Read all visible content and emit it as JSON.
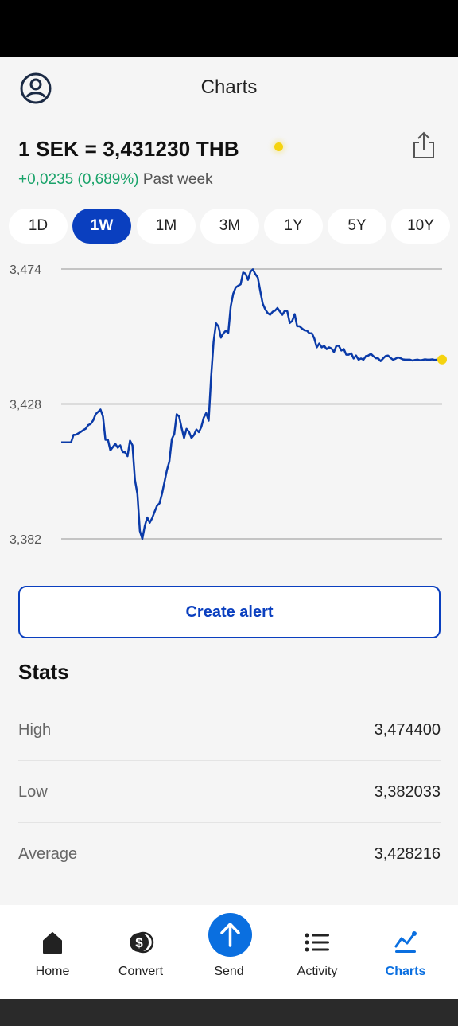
{
  "header": {
    "title": "Charts"
  },
  "rate": {
    "pair_text": "1 SEK = 3,431230 THB",
    "change_value": "+0,0235 (0,689%)",
    "change_period": "Past week"
  },
  "ranges": [
    {
      "label": "1D",
      "active": false
    },
    {
      "label": "1W",
      "active": true
    },
    {
      "label": "1M",
      "active": false
    },
    {
      "label": "3M",
      "active": false
    },
    {
      "label": "1Y",
      "active": false
    },
    {
      "label": "5Y",
      "active": false
    },
    {
      "label": "10Y",
      "active": false
    }
  ],
  "chart_data": {
    "type": "line",
    "title": "",
    "xlabel": "",
    "ylabel": "",
    "ylim": [
      3.382,
      3.474
    ],
    "y_ticks": [
      "3,474",
      "3,428",
      "3,382"
    ],
    "grid": true,
    "line_color": "#0a3aa8",
    "end_marker_color": "#f5d30f",
    "series": [
      {
        "values": [
          3.4149,
          3.4149,
          3.4149,
          3.4149,
          3.4149,
          3.4175,
          3.4175,
          3.418,
          3.4185,
          3.4191,
          3.4196,
          3.4208,
          3.4212,
          3.4224,
          3.4245,
          3.4253,
          3.4261,
          3.4237,
          3.4158,
          3.4158,
          3.4122,
          3.4133,
          3.4144,
          3.4131,
          3.4139,
          3.4116,
          3.4115,
          3.4102,
          3.4155,
          3.4139,
          3.4021,
          3.3973,
          3.3847,
          3.382,
          3.3864,
          3.3893,
          3.3875,
          3.389,
          3.3912,
          3.3933,
          3.3941,
          3.3973,
          3.4013,
          3.4054,
          3.4084,
          3.416,
          3.4178,
          3.4245,
          3.4237,
          3.4198,
          3.4164,
          3.4195,
          3.4185,
          3.4164,
          3.4174,
          3.4193,
          3.4184,
          3.4201,
          3.4233,
          3.4249,
          3.4223,
          3.4372,
          3.4492,
          3.4555,
          3.4544,
          3.4506,
          3.4521,
          3.453,
          3.4523,
          3.4613,
          3.4656,
          3.4677,
          3.4683,
          3.4688,
          3.4728,
          3.4724,
          3.4703,
          3.4731,
          3.4739,
          3.4723,
          3.4711,
          3.4665,
          3.4622,
          3.4603,
          3.459,
          3.4584,
          3.4594,
          3.4598,
          3.4607,
          3.4595,
          3.4584,
          3.4598,
          3.4596,
          3.4556,
          3.4563,
          3.4586,
          3.4545,
          3.4545,
          3.4537,
          3.4531,
          3.453,
          3.4521,
          3.4521,
          3.4503,
          3.4473,
          3.4486,
          3.4473,
          3.4478,
          3.4467,
          3.4473,
          3.4469,
          3.4457,
          3.4478,
          3.4478,
          3.4462,
          3.4467,
          3.4448,
          3.4448,
          3.4453,
          3.4435,
          3.4445,
          3.4431,
          3.4435,
          3.4431,
          3.4443,
          3.4445,
          3.4451,
          3.4443,
          3.4436,
          3.4435,
          3.4426,
          3.4435,
          3.4443,
          3.4445,
          3.4437,
          3.4431,
          3.4434,
          3.4439,
          3.4436,
          3.4432,
          3.4431,
          3.4431,
          3.4431,
          3.4428,
          3.443,
          3.4431,
          3.4429,
          3.443,
          3.4432,
          3.4431,
          3.4431,
          3.4432,
          3.443,
          3.4431,
          3.4431,
          3.44312
        ]
      }
    ]
  },
  "alert": {
    "label": "Create alert"
  },
  "stats": {
    "title": "Stats",
    "rows": [
      {
        "label": "High",
        "value": "3,474400"
      },
      {
        "label": "Low",
        "value": "3,382033"
      },
      {
        "label": "Average",
        "value": "3,428216"
      }
    ]
  },
  "nav": {
    "items": [
      {
        "label": "Home",
        "icon": "home-icon",
        "active": false
      },
      {
        "label": "Convert",
        "icon": "convert-icon",
        "active": false
      },
      {
        "label": "Send",
        "icon": "send-icon",
        "active": false
      },
      {
        "label": "Activity",
        "icon": "activity-icon",
        "active": false
      },
      {
        "label": "Charts",
        "icon": "charts-icon",
        "active": true
      }
    ],
    "active_color": "#0a6fe0"
  },
  "colors": {
    "accent": "#0a3fbf",
    "positive": "#1aa36a",
    "live": "#f5d30f"
  }
}
